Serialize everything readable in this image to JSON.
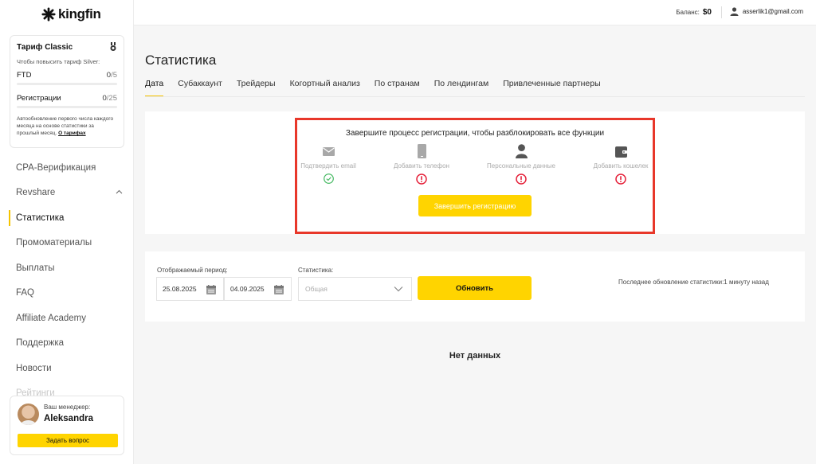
{
  "brand": {
    "name": "kingfin",
    "accent": "#ffd400",
    "highlight": "#e8372a"
  },
  "sidebar": {
    "tariff": {
      "title": "Тариф Classic",
      "upgrade_text": "Чтобы повысить тариф Silver:",
      "metrics": [
        {
          "label": "FTD",
          "value": "0",
          "total": "/5",
          "progress": 0
        },
        {
          "label": "Регистрации",
          "value": "0",
          "total": "/25",
          "progress": 0
        }
      ],
      "note": "Автообновление первого числа каждого месяца на основе статистики за прошлый месяц.",
      "note_link": "О тарифах"
    },
    "nav": [
      {
        "label": "CPA-Верификация"
      },
      {
        "label": "Revshare",
        "expandable": true
      },
      {
        "label": "Статистика",
        "active": true
      },
      {
        "label": "Промоматериалы"
      },
      {
        "label": "Выплаты"
      },
      {
        "label": "FAQ"
      },
      {
        "label": "Affiliate Academy"
      },
      {
        "label": "Поддержка"
      },
      {
        "label": "Новости"
      },
      {
        "label": "Рейтинги"
      }
    ],
    "manager": {
      "label": "Ваш менеджер:",
      "name": "Aleksandra",
      "button": "Задать вопрос"
    }
  },
  "topbar": {
    "balance_label": "Баланс:",
    "balance_value": "$0",
    "user_email": "asserlik1@gmail.com"
  },
  "page": {
    "title": "Статистика",
    "tabs": [
      {
        "label": "Дата",
        "active": true
      },
      {
        "label": "Субаккаунт"
      },
      {
        "label": "Трейдеры"
      },
      {
        "label": "Когортный анализ"
      },
      {
        "label": "По странам"
      },
      {
        "label": "По лендингам"
      },
      {
        "label": "Привлеченные партнеры"
      }
    ]
  },
  "registration": {
    "title": "Завершите процесс регистрации, чтобы разблокировать все функции",
    "steps": [
      {
        "label": "Подтвердить email",
        "icon": "mail-icon",
        "status": "done"
      },
      {
        "label": "Добавить телефон",
        "icon": "phone-icon",
        "status": "pending"
      },
      {
        "label": "Персональные данные",
        "icon": "user-icon",
        "status": "pending"
      },
      {
        "label": "Добавить кошелек",
        "icon": "wallet-icon",
        "status": "pending"
      }
    ],
    "button": "Завершить регистрацию"
  },
  "filters": {
    "period_label": "Отображаемый период:",
    "date_from": "25.08.2025",
    "date_to": "04.09.2025",
    "stats_label": "Статистика:",
    "stats_value": "Общая",
    "update_button": "Обновить",
    "last_update": "Последнее обновление статистики:1 минуту назад"
  },
  "empty_state": "Нет данных"
}
